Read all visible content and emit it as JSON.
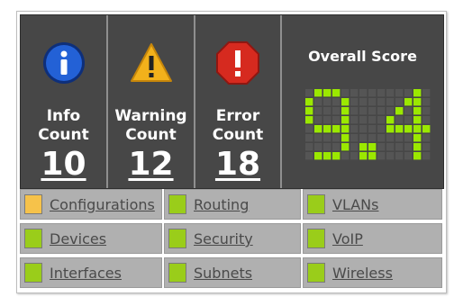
{
  "info": {
    "label": "Info\nCount",
    "count": "10"
  },
  "warning": {
    "label": "Warning\nCount",
    "count": "12"
  },
  "error": {
    "label": "Error\nCount",
    "count": "18"
  },
  "score": {
    "title": "Overall Score",
    "value": "9.4"
  },
  "categories": [
    {
      "label": "Configurations",
      "status_color": "#f6c24a"
    },
    {
      "label": "Routing",
      "status_color": "#9acd1a"
    },
    {
      "label": "VLANs",
      "status_color": "#9acd1a"
    },
    {
      "label": "Devices",
      "status_color": "#9acd1a"
    },
    {
      "label": "Security",
      "status_color": "#9acd1a"
    },
    {
      "label": "VoIP",
      "status_color": "#9acd1a"
    },
    {
      "label": "Interfaces",
      "status_color": "#9acd1a"
    },
    {
      "label": "Subnets",
      "status_color": "#9acd1a"
    },
    {
      "label": "Wireless",
      "status_color": "#9acd1a"
    }
  ],
  "colors": {
    "panel_bg": "#474747",
    "digit_on": "#9be800",
    "digit_off": "#555555"
  }
}
